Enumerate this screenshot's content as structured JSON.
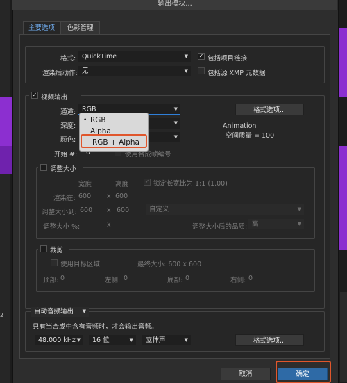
{
  "window": {
    "title": "输出模块..."
  },
  "tabs": [
    {
      "label": "主要选项",
      "active": true
    },
    {
      "label": "色彩管理",
      "active": false
    }
  ],
  "main": {
    "format_label": "格式:",
    "format_value": "QuickTime",
    "include_project_link_label": "包括项目链接",
    "include_project_link_checked": true,
    "post_render_label": "渲染后动作:",
    "post_render_value": "无",
    "include_xmp_label": "包括源 XMP 元数据",
    "include_xmp_checked": false
  },
  "video_output": {
    "label": "视频输出",
    "checked": true,
    "channels_label": "通道:",
    "channels_value": "RGB",
    "depth_label": "深度:",
    "color_label": "颜色:",
    "start_label": "开始 #:",
    "start_value": "0",
    "use_comp_frame_label": "使用合成帧编号",
    "format_options_label": "格式选项...",
    "codec_info_line1": "Animation",
    "codec_info_line2": "空间质量 = 100",
    "channel_options": [
      {
        "label": "RGB",
        "selected": true
      },
      {
        "label": "Alpha",
        "selected": false
      },
      {
        "label": "RGB + Alpha",
        "selected": false,
        "highlighted": true
      }
    ]
  },
  "resize": {
    "label": "调整大小",
    "checked": false,
    "width_header": "宽度",
    "height_header": "高度",
    "lock_aspect_label": "锁定长宽比为 1:1 (1.00)",
    "lock_aspect_checked": true,
    "render_at_label": "渲染在:",
    "render_at_width": "600",
    "render_at_height": "600",
    "resize_to_label": "调整大小到:",
    "resize_to_width": "600",
    "resize_to_height": "600",
    "resize_preset": "自定义",
    "resize_percent_label": "调整大小 %:",
    "x_symbol": "x",
    "quality_label": "调整大小后的品质:",
    "quality_value": "高"
  },
  "crop": {
    "label": "裁剪",
    "checked": false,
    "use_region_label": "使用目标区域",
    "use_region_checked": false,
    "final_size_label": "最终大小: 600 x 600",
    "top_label": "顶部:",
    "top_value": "0",
    "left_label": "左侧:",
    "left_value": "0",
    "bottom_label": "底部:",
    "bottom_value": "0",
    "right_label": "右侧:",
    "right_value": "0"
  },
  "audio": {
    "mode_value": "自动音频输出",
    "note": "只有当合成中含有音频时，才会输出音频。",
    "sample_rate": "48.000 kHz",
    "bit_depth": "16 位",
    "channels": "立体声",
    "format_options_label": "格式选项..."
  },
  "footer": {
    "cancel_label": "取消",
    "ok_label": "确定"
  },
  "background": {
    "corner_text": "2"
  },
  "colors": {
    "accent_tab": "#6ea9ea",
    "primary_button": "#2e6aa6",
    "highlight_outline": "#e0562c",
    "background_purple": "#8c2fd0"
  }
}
